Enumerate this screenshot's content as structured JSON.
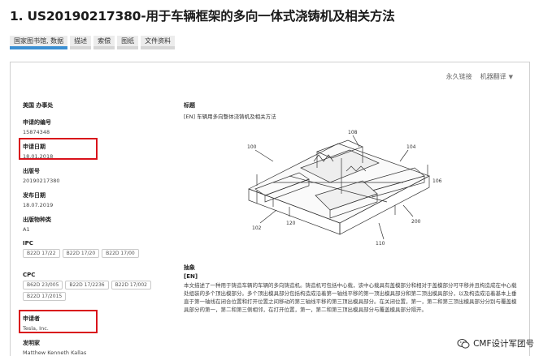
{
  "title": "1. US20190217380-用于车辆框架的多向一体式浇铸机及相关方法",
  "tabs": [
    {
      "label": "国家图书馆, 数据"
    },
    {
      "label": "描述"
    },
    {
      "label": "索偿"
    },
    {
      "label": "图纸"
    },
    {
      "label": "文件资料"
    }
  ],
  "toolbar": {
    "permalink": "永久链接",
    "translate": "机器翻译"
  },
  "fields": {
    "office": {
      "label": "美国 办事处"
    },
    "app_number": {
      "label": "申请的编号",
      "value": "15874348"
    },
    "app_date": {
      "label": "申请日期",
      "value": "18.01.2018"
    },
    "pub_number": {
      "label": "出版号",
      "value": "20190217380"
    },
    "pub_date": {
      "label": "发布日期",
      "value": "18.07.2019"
    },
    "pub_kind": {
      "label": "出版物种类",
      "value": "A1"
    },
    "ipc": {
      "label": "IPC",
      "chips": [
        "B22D 17/22",
        "B22D 17/20",
        "B22D 17/00"
      ]
    },
    "cpc": {
      "label": "CPC",
      "chips": [
        "B62D 23/005",
        "B22D 17/2236",
        "B22D 17/002",
        "B22D 17/2015"
      ]
    },
    "applicant": {
      "label": "申请者",
      "value": "Tesla, Inc."
    },
    "inventor": {
      "label": "发明家",
      "value": "Matthew Kenneth Kallas"
    }
  },
  "heading": {
    "label": "标题",
    "value": "[EN] 车辆用多向整体浇铸机及相关方法"
  },
  "drawing_labels": [
    "100",
    "108",
    "104",
    "102",
    "200",
    "110",
    "106",
    "120"
  ],
  "abstract": {
    "label": "抽象",
    "lang": "[EN]",
    "text": "本文描述了一种用于铸造车辆的车辆的多向铸造机。铸造机可包括中心载，该中心载具有盖模部分和相对于盖模部分可平移并且构造成在中心载处组装的多个顶出模部分。多个顶出模具部分包括构造成沿着第一轴线平移的第一顶出模具部分和第二顶出模具部分，以及构造成沿着基本上垂直于第一轴线在闭合位置和打开位置之间移动的第三轴线平移的第三顶出模具部分。在关闭位置，第一，第二和第三顶出模具部分分别与覆盖模具部分的第一，第二和第三侧相邻，在打开位置，第一，第二和第三顶出模具部分与覆盖模具部分隔开。"
  },
  "watermark": "CMF设计军团号"
}
